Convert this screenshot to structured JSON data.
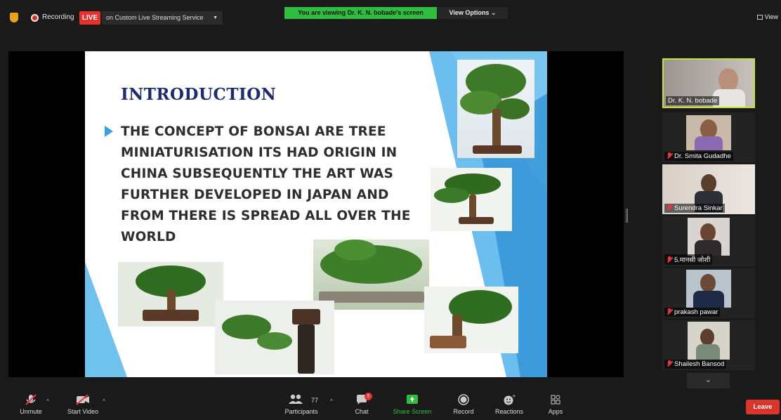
{
  "topbar": {
    "recording_label": "Recording",
    "live_badge": "LIVE",
    "live_service": "on Custom Live Streaming Service",
    "viewing_banner": "You are viewing Dr. K. N. bobade's screen",
    "view_options": "View Options",
    "view_button": "View"
  },
  "slide": {
    "title": "INTRODUCTION",
    "body": "THE CONCEPT OF BONSAI ARE TREE MINIATURISATION ITS HAD ORIGIN IN CHINA SUBSEQUENTLY THE ART WAS FURTHER DEVELOPED IN JAPAN AND FROM THERE IS SPREAD ALL OVER THE WORLD"
  },
  "participants": [
    {
      "name": "Dr. K. N. bobade",
      "active": true,
      "muted": false
    },
    {
      "name": "Dr. Smita Gudadhe",
      "active": false,
      "muted": true
    },
    {
      "name": "Surendra Sinkar",
      "active": false,
      "muted": true
    },
    {
      "name": "5.मानसी जोशी",
      "active": false,
      "muted": true
    },
    {
      "name": "prakash pawar",
      "active": false,
      "muted": true
    },
    {
      "name": "Shailesh Bansod",
      "active": false,
      "muted": true
    }
  ],
  "toolbar": {
    "unmute": "Unmute",
    "start_video": "Start Video",
    "participants": "Participants",
    "participants_count": "77",
    "chat": "Chat",
    "chat_badge": "5",
    "share_screen": "Share Screen",
    "record": "Record",
    "reactions": "Reactions",
    "apps": "Apps",
    "leave": "Leave"
  },
  "colors": {
    "live_red": "#e5322d",
    "banner_green": "#2ebd3f",
    "active_speaker_border": "#c6e037",
    "slide_title_navy": "#1e2b6e",
    "slide_accent_blue": "#3aa0e0",
    "share_green": "#2ebd3f"
  }
}
